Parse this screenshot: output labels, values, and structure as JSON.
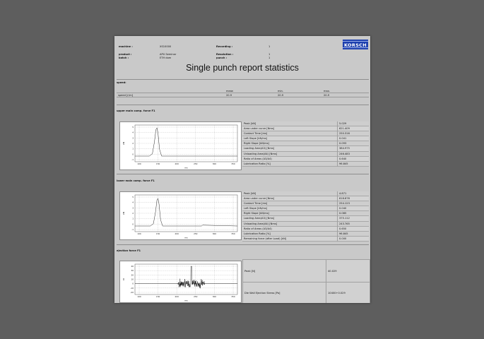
{
  "header": {
    "machine_label": "machine :",
    "machine_value": "XS10000",
    "recording_label": "Recording :",
    "recording_value": "1",
    "product_label": "product :",
    "product_value": "APU Seminar",
    "batch_label": "batch :",
    "batch_value": "ETH dom",
    "resolution_label": "Resolution :",
    "resolution_value": "1",
    "punch_label": "punch :",
    "punch_value": "1"
  },
  "logo": {
    "text": "KORSCH",
    "color": "#1c3fae"
  },
  "title": "Single punch report statistics",
  "speed": {
    "section_title": "speed:",
    "headers": [
      "mean",
      "min.",
      "max."
    ],
    "row_label": "speed [r/m]",
    "values": [
      "20.9",
      "20.9",
      "20.9"
    ]
  },
  "sections": [
    {
      "title": "upper main comp. force F1",
      "params": [
        {
          "label": "Peak [kN]",
          "value": "5.029"
        },
        {
          "label": "Area under curve [Nms]",
          "value": "621.409"
        },
        {
          "label": "Contact Time [ms]",
          "value": "250.316"
        },
        {
          "label": "Left Slope [kN/ms]",
          "value": "0.041"
        },
        {
          "label": "Right Slope [kN/ms]",
          "value": "0.093"
        },
        {
          "label": "Loading Area(A3) [Nms]",
          "value": "384.975"
        },
        {
          "label": "Unloading Area(A4) [Nms]",
          "value": "246.483"
        },
        {
          "label": "Ratio of Areas (A3/A4)",
          "value": "0.640"
        },
        {
          "label": "Lubrication Ratio [%]",
          "value": "96.845"
        }
      ]
    },
    {
      "title": "lower main comp. force F1",
      "params": [
        {
          "label": "Peak [kN]",
          "value": "4.871"
        },
        {
          "label": "Area under curve [Nms]",
          "value": "618.878"
        },
        {
          "label": "Contact Time [ms]",
          "value": "254.123"
        },
        {
          "label": "Left Slope [kN/ms]",
          "value": "0.040"
        },
        {
          "label": "Right Slope [kN/ms]",
          "value": "0.085"
        },
        {
          "label": "Loading Area(A3) [Nms]",
          "value": "375.112"
        },
        {
          "label": "Unloading Area(A4) [Nms]",
          "value": "243.765"
        },
        {
          "label": "Ratio of Areas (A3/A4)",
          "value": "0.650"
        },
        {
          "label": "Lubrication Ratio [%]",
          "value": "96.845"
        },
        {
          "label": "Remaining force (after Load) [kN]",
          "value": "0.000"
        }
      ]
    },
    {
      "title": "ejection force F1",
      "params": [
        {
          "label": "Peak [N]",
          "value": "40.029"
        },
        {
          "label": "Die Wall Ejection Stress [Pa]",
          "value": "10400+0.029"
        }
      ]
    }
  ],
  "chart_data": [
    {
      "type": "line",
      "ylabel": "kN",
      "xlabel": "ms",
      "x_ticks": [
        "100",
        "150",
        "200",
        "250",
        "300",
        "350"
      ],
      "y_ticks": [
        "5",
        "4",
        "3",
        "2",
        "1",
        "0",
        "-1"
      ],
      "xlim": [
        0,
        100
      ],
      "ylim": [
        -1,
        5.5
      ],
      "series": [
        {
          "x": [
            0,
            14,
            17,
            19,
            20.5,
            21.5,
            22.5,
            24,
            26,
            100
          ],
          "y": [
            0,
            0,
            0.4,
            2.5,
            4.7,
            5.0,
            4.0,
            1.2,
            0,
            0
          ]
        }
      ]
    },
    {
      "type": "line",
      "ylabel": "kN",
      "xlabel": "ms",
      "x_ticks": [
        "100",
        "150",
        "200",
        "250",
        "300",
        "350"
      ],
      "y_ticks": [
        "5",
        "4",
        "3",
        "2",
        "1",
        "0",
        "-1"
      ],
      "xlim": [
        0,
        100
      ],
      "ylim": [
        -1,
        5.5
      ],
      "series": [
        {
          "x": [
            0,
            15,
            18,
            20,
            21.5,
            22.5,
            23.5,
            25,
            27,
            65,
            66,
            100
          ],
          "y": [
            0,
            0,
            0.4,
            2.4,
            4.6,
            4.87,
            3.9,
            1.1,
            0,
            0,
            0.15,
            0
          ]
        }
      ]
    },
    {
      "type": "line",
      "ylabel": "N",
      "xlabel": "ms",
      "x_ticks": [
        "100",
        "150",
        "200",
        "250",
        "300",
        "350"
      ],
      "y_ticks": [
        "40",
        "30",
        "20",
        "10",
        "0",
        "-10",
        "-20"
      ],
      "xlim": [
        0,
        100
      ],
      "ylim": [
        -25,
        45
      ],
      "series": [
        {
          "noise_band": [
            42,
            68
          ],
          "center": 0,
          "amplitude": 9,
          "peak_x": 55,
          "peak": 40
        }
      ]
    }
  ]
}
